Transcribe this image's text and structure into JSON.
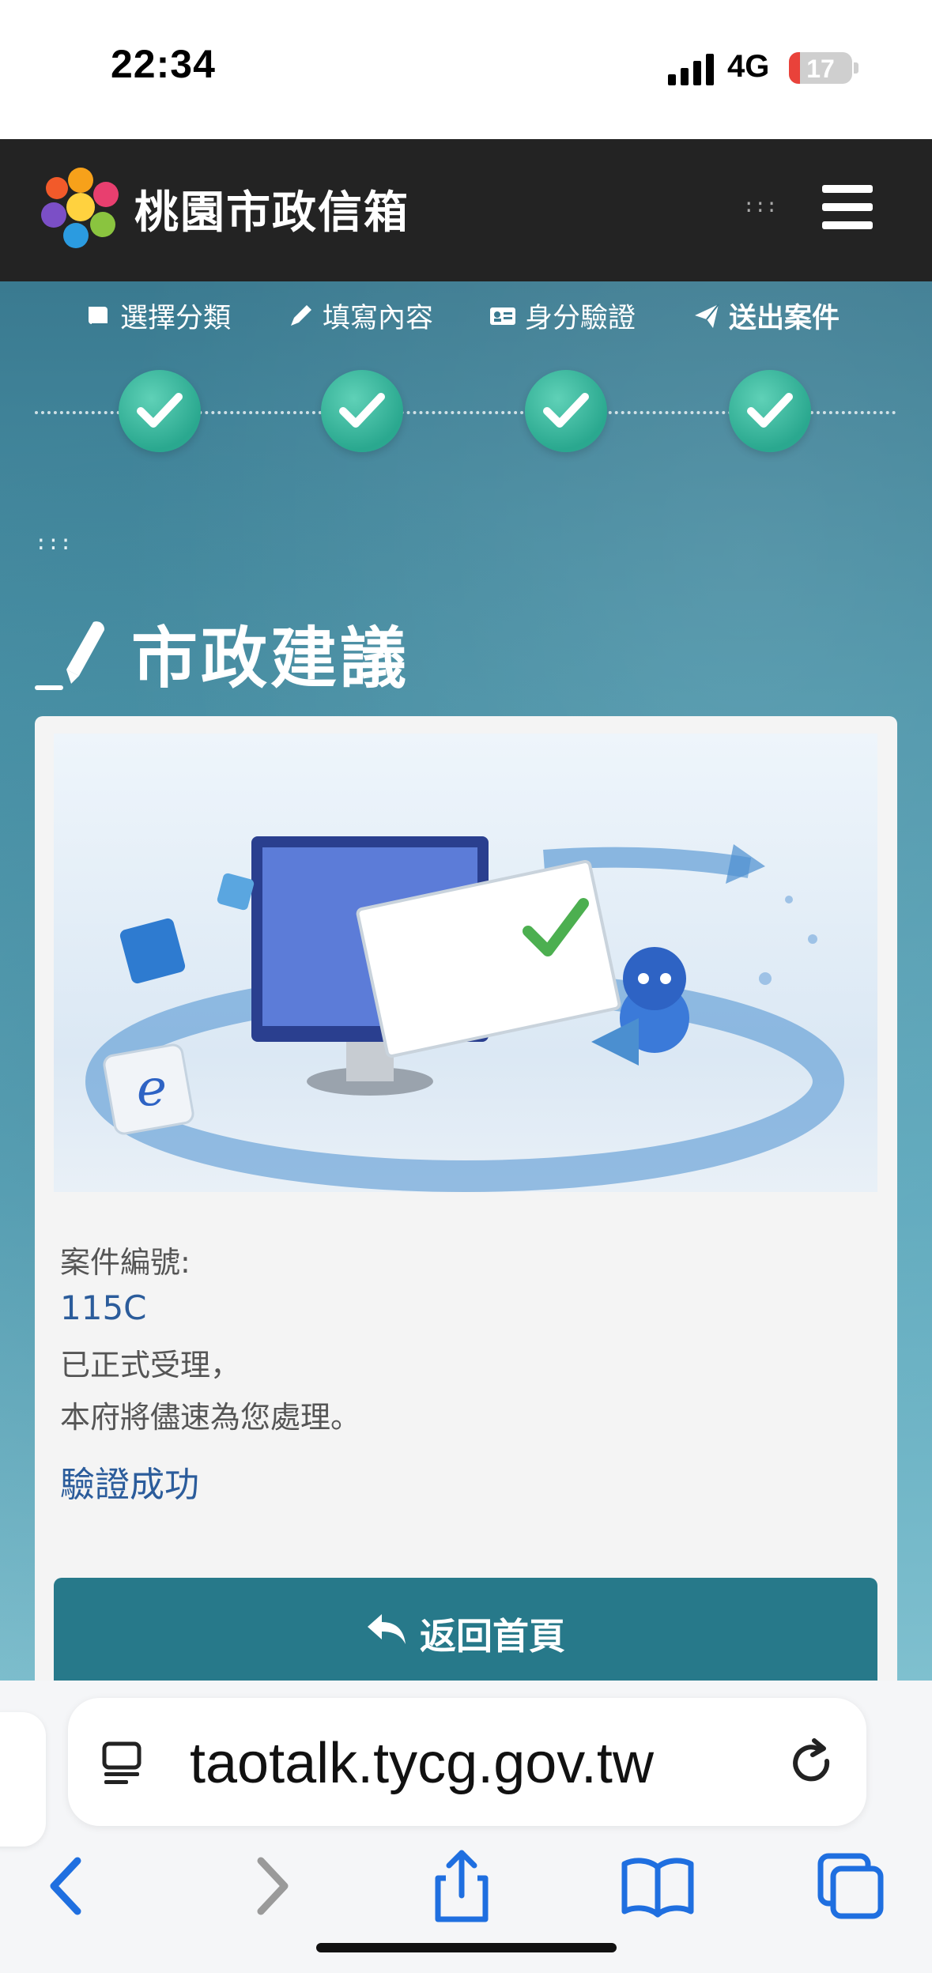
{
  "status_bar": {
    "time": "22:34",
    "network": "4G",
    "battery": "17",
    "battery_level": 0.17
  },
  "header": {
    "site_title": "桃園市政信箱",
    "accesskey": ":::"
  },
  "steps": [
    {
      "label": "選擇分類",
      "icon": "book-icon",
      "completed": true
    },
    {
      "label": "填寫內容",
      "icon": "pencil-icon",
      "completed": true
    },
    {
      "label": "身分驗證",
      "icon": "id-card-icon",
      "completed": true
    },
    {
      "label": "送出案件",
      "icon": "paper-plane-icon",
      "completed": true
    }
  ],
  "main": {
    "accesskey": ":::",
    "page_title": "市政建議",
    "case_label": "案件編號:",
    "case_number": "115C",
    "accepted_line1": "已正式受理，",
    "accepted_line2": "本府將儘速為您處理。",
    "verify_status": "驗證成功",
    "home_button_label": "返回首頁"
  },
  "browser": {
    "url": "taotalk.tycg.gov.tw"
  },
  "colors": {
    "header_bg": "#232323",
    "accent": "#27798a",
    "check": "#2aa88f",
    "link_blue": "#2b5c9b"
  }
}
